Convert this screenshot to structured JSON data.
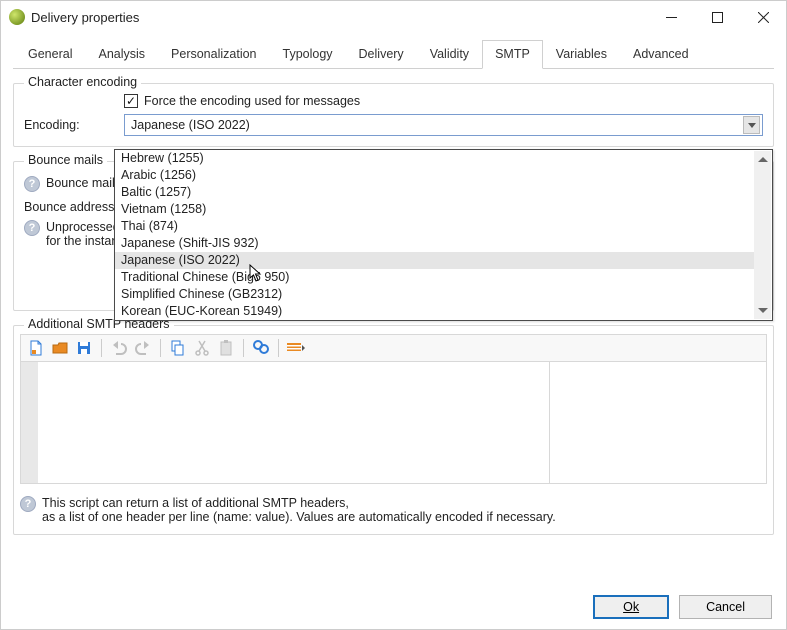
{
  "window": {
    "title": "Delivery properties"
  },
  "tabs": [
    "General",
    "Analysis",
    "Personalization",
    "Typology",
    "Delivery",
    "Validity",
    "SMTP",
    "Variables",
    "Advanced"
  ],
  "active_tab_index": 6,
  "char_encoding": {
    "legend": "Character encoding",
    "force_label": "Force the encoding used for messages",
    "force_checked": true,
    "encoding_label": "Encoding:",
    "selected": "Japanese (ISO 2022)",
    "options": [
      "Hebrew (1255)",
      "Arabic (1256)",
      "Baltic (1257)",
      "Vietnam (1258)",
      "Thai (874)",
      "Japanese (Shift-JIS 932)",
      "Japanese (ISO 2022)",
      "Traditional Chinese (Big5 950)",
      "Simplified Chinese (GB2312)",
      "Korean (EUC-Korean 51949)"
    ],
    "highlight_index": 6
  },
  "bounce": {
    "legend": "Bounce mails",
    "management_label": "Bounce mails",
    "address_label": "Bounce address:",
    "unprocessed_line1": "Unprocessed",
    "unprocessed_line2": "for the instan"
  },
  "addsmtp": {
    "legend": "Additional SMTP headers",
    "note_line1": "This script can return a list of additional SMTP headers,",
    "note_line2": "as a list of one header per line (name: value). Values are automatically encoded if necessary."
  },
  "toolbar_icons": [
    "file-icon",
    "open-icon",
    "save-icon",
    "undo-icon",
    "redo-icon",
    "copy-icon",
    "cut-icon",
    "paste-icon",
    "find-icon",
    "highlight-icon"
  ],
  "buttons": {
    "ok": "Ok",
    "cancel": "Cancel"
  },
  "colors": {
    "accent": "#1a6fbc",
    "highlight_bg": "#e5e5e5",
    "toolbar_orange": "#e98a23",
    "toolbar_blue": "#2f7bd8"
  }
}
